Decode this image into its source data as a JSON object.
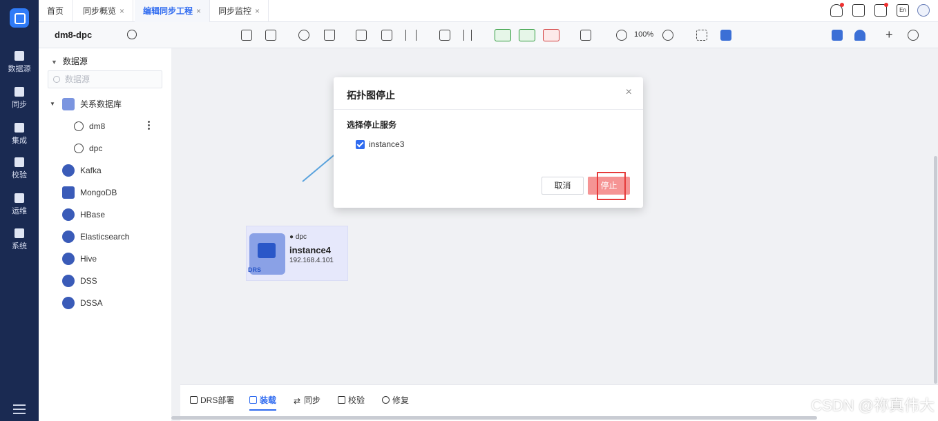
{
  "nav": {
    "items": [
      {
        "label": "数据源",
        "icon": "database-icon"
      },
      {
        "label": "同步",
        "icon": "sync-icon"
      },
      {
        "label": "集成",
        "icon": "integration-icon"
      },
      {
        "label": "校验",
        "icon": "check-icon"
      },
      {
        "label": "运维",
        "icon": "ops-icon"
      },
      {
        "label": "系统",
        "icon": "system-icon"
      }
    ]
  },
  "tabs": [
    {
      "label": "首页"
    },
    {
      "label": "同步概览",
      "close": "×"
    },
    {
      "label": "编辑同步工程",
      "close": "×"
    },
    {
      "label": "同步监控",
      "close": "×"
    }
  ],
  "top_right": {
    "lang": "En"
  },
  "toolbar": {
    "project_name": "dm8-dpc",
    "zoom": "100%"
  },
  "tree": {
    "header": "数据源",
    "search_placeholder": "数据源",
    "group": "关系数据库",
    "children": [
      "dm8",
      "dpc"
    ],
    "sources": [
      "Kafka",
      "MongoDB",
      "HBase",
      "Elasticsearch",
      "Hive",
      "DSS",
      "DSSA"
    ]
  },
  "node": {
    "source": "dpc",
    "name": "instance4",
    "ip": "192.168.4.101",
    "badge": "DRS"
  },
  "bottom_tabs": [
    {
      "label": "DRS部署"
    },
    {
      "label": "装载"
    },
    {
      "label": "同步"
    },
    {
      "label": "校验"
    },
    {
      "label": "修复"
    }
  ],
  "watermark": "CSDN @祢真伟大",
  "modal": {
    "title": "拓扑图停止",
    "close": "×",
    "label": "选择停止服务",
    "checkbox_label": "instance3",
    "checked": true,
    "cancel": "取消",
    "confirm": "停止"
  }
}
